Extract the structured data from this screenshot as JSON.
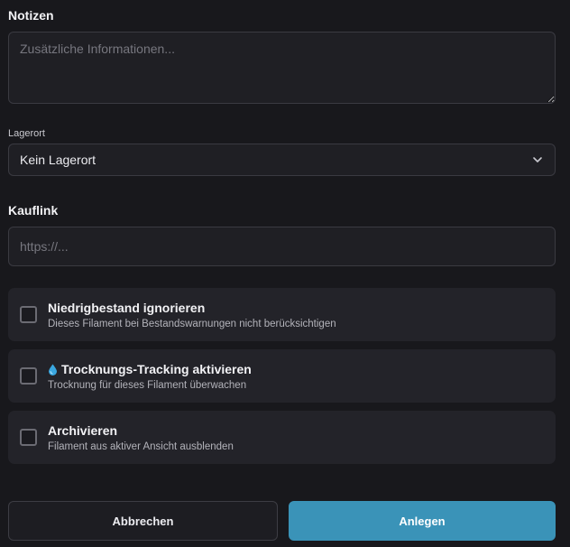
{
  "notes": {
    "title": "Notizen",
    "placeholder": "Zusätzliche Informationen..."
  },
  "location": {
    "label": "Lagerort",
    "selected": "Kein Lagerort",
    "icon": "chevron-down-icon"
  },
  "buy_link": {
    "title": "Kauflink",
    "placeholder": "https://..."
  },
  "options": [
    {
      "title": "Niedrigbestand ignorieren",
      "description": "Dieses Filament bei Bestandswarnungen nicht berücksichtigen",
      "checked": false
    },
    {
      "title": "Trocknungs-Tracking aktivieren",
      "description": "Trocknung für dieses Filament überwachen",
      "checked": false,
      "icon": "water-drop-icon"
    },
    {
      "title": "Archivieren",
      "description": "Filament aus aktiver Ansicht ausblenden",
      "checked": false
    }
  ],
  "actions": {
    "cancel_label": "Abbrechen",
    "submit_label": "Anlegen"
  },
  "colors": {
    "background": "#18181c",
    "card": "#232329",
    "accent": "#3a93b8"
  }
}
